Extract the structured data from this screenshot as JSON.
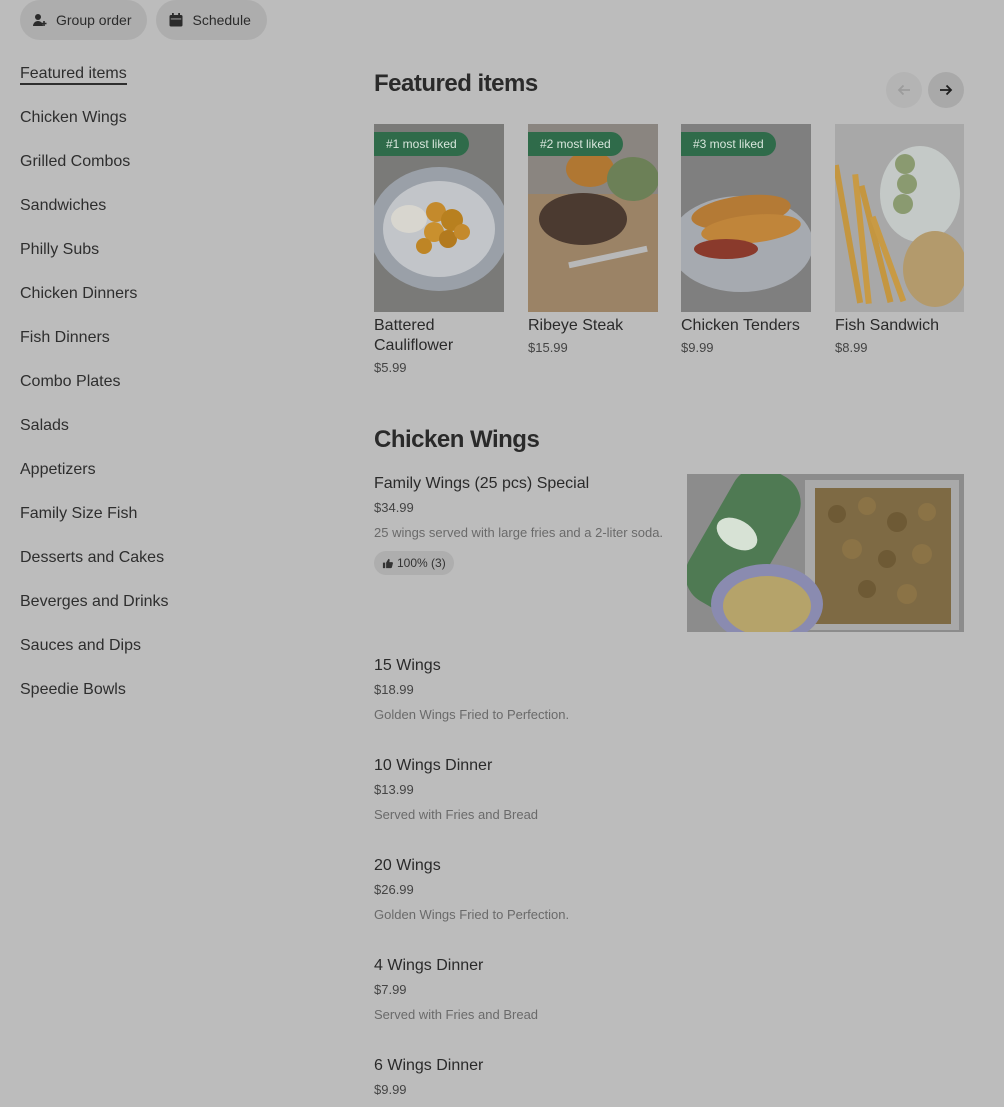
{
  "top_buttons": {
    "group_order": "Group order",
    "schedule": "Schedule"
  },
  "sidebar": {
    "items": [
      {
        "label": "Featured items"
      },
      {
        "label": "Chicken Wings"
      },
      {
        "label": "Grilled Combos"
      },
      {
        "label": "Sandwiches"
      },
      {
        "label": "Philly Subs"
      },
      {
        "label": "Chicken Dinners"
      },
      {
        "label": "Fish Dinners"
      },
      {
        "label": "Combo Plates"
      },
      {
        "label": "Salads"
      },
      {
        "label": "Appetizers"
      },
      {
        "label": "Family Size Fish"
      },
      {
        "label": "Desserts and Cakes"
      },
      {
        "label": "Beverges and Drinks"
      },
      {
        "label": "Sauces and Dips"
      },
      {
        "label": "Speedie Bowls"
      }
    ]
  },
  "featured": {
    "title": "Featured items",
    "items": [
      {
        "badge": "#1 most liked",
        "name": "Battered Cauliflower",
        "price": "$5.99"
      },
      {
        "badge": "#2 most liked",
        "name": "Ribeye Steak",
        "price": "$15.99"
      },
      {
        "badge": "#3 most liked",
        "name": "Chicken Tenders",
        "price": "$9.99"
      },
      {
        "badge": "",
        "name": "Fish Sandwich",
        "price": "$8.99"
      }
    ]
  },
  "chicken_wings": {
    "title": "Chicken Wings",
    "items": [
      {
        "name": "Family Wings (25 pcs) Special",
        "price": "$34.99",
        "desc": "25 wings served with large fries and a 2-liter soda.",
        "like": "100% (3)"
      },
      {
        "name": "15 Wings",
        "price": "$18.99",
        "desc": "Golden Wings Fried to Perfection."
      },
      {
        "name": "10 Wings Dinner",
        "price": "$13.99",
        "desc": "Served with Fries and Bread"
      },
      {
        "name": "20 Wings",
        "price": "$26.99",
        "desc": "Golden Wings Fried to Perfection."
      },
      {
        "name": "4 Wings Dinner",
        "price": "$7.99",
        "desc": "Served with Fries and Bread"
      },
      {
        "name": "6 Wings Dinner",
        "price": "$9.99",
        "desc": ""
      }
    ]
  }
}
